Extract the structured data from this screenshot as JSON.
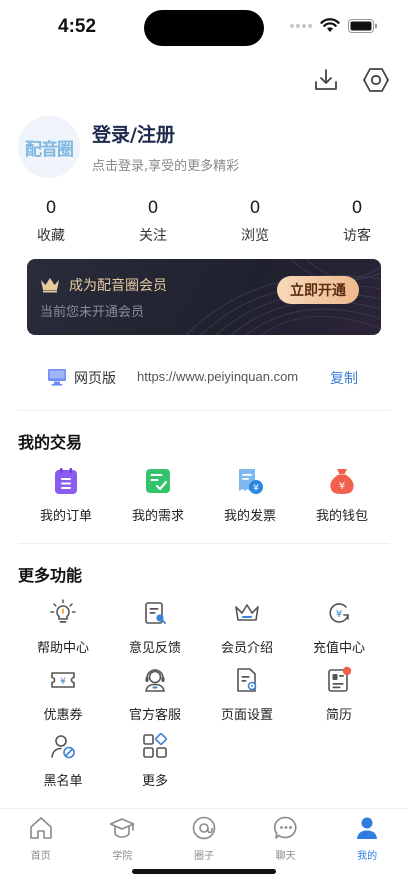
{
  "status": {
    "time": "4:52"
  },
  "top_icons": [
    "download-icon",
    "settings-icon"
  ],
  "profile": {
    "avatar_text": "配音圈",
    "title": "登录/注册",
    "subtitle": "点击登录,享受的更多精彩"
  },
  "stats": [
    {
      "value": "0",
      "label": "收藏"
    },
    {
      "value": "0",
      "label": "关注"
    },
    {
      "value": "0",
      "label": "浏览"
    },
    {
      "value": "0",
      "label": "访客"
    }
  ],
  "vip": {
    "title": "成为配音圈会员",
    "subtitle": "当前您未开通会员",
    "button": "立即开通"
  },
  "web": {
    "label": "网页版",
    "url": "https://www.peiyinquan.com",
    "copy": "复制"
  },
  "trade": {
    "title": "我的交易",
    "items": [
      {
        "label": "我的订单",
        "icon": "order-icon"
      },
      {
        "label": "我的需求",
        "icon": "demand-icon"
      },
      {
        "label": "我的发票",
        "icon": "invoice-icon"
      },
      {
        "label": "我的钱包",
        "icon": "wallet-icon"
      }
    ]
  },
  "more": {
    "title": "更多功能",
    "items": [
      {
        "label": "帮助中心",
        "icon": "lightbulb-icon"
      },
      {
        "label": "意见反馈",
        "icon": "feedback-icon"
      },
      {
        "label": "会员介绍",
        "icon": "crown-icon"
      },
      {
        "label": "充值中心",
        "icon": "recharge-icon"
      },
      {
        "label": "优惠券",
        "icon": "coupon-icon"
      },
      {
        "label": "官方客服",
        "icon": "headset-icon"
      },
      {
        "label": "页面设置",
        "icon": "page-settings-icon"
      },
      {
        "label": "简历",
        "icon": "resume-icon"
      },
      {
        "label": "黑名单",
        "icon": "blacklist-icon"
      },
      {
        "label": "更多",
        "icon": "more-grid-icon"
      }
    ]
  },
  "tabs": [
    {
      "label": "首页",
      "icon": "home-icon"
    },
    {
      "label": "学院",
      "icon": "academy-icon"
    },
    {
      "label": "圈子",
      "icon": "circle-icon"
    },
    {
      "label": "聊天",
      "icon": "chat-icon"
    },
    {
      "label": "我的",
      "icon": "profile-icon",
      "active": true
    }
  ],
  "colors": {
    "accent": "#2f7de1",
    "vip_gold": "#e7c9a0",
    "icon_purple": "#8a5cf0",
    "icon_green": "#32c36c",
    "icon_blue": "#3b9ae8",
    "icon_red": "#f0604d"
  }
}
